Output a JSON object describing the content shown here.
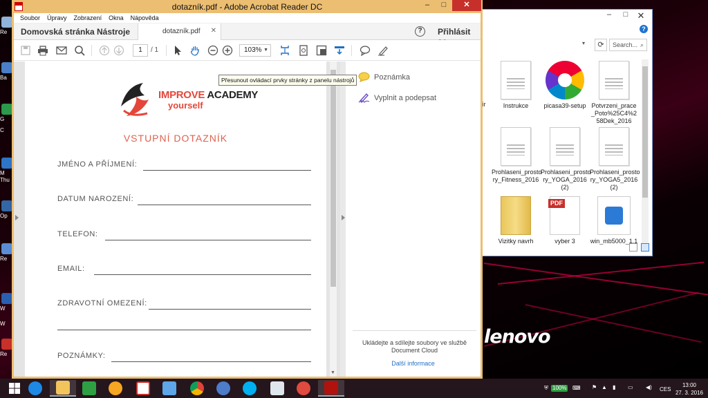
{
  "acrobat": {
    "title": "dotazník.pdf - Adobe Acrobat Reader DC",
    "menu": [
      "Soubor",
      "Úpravy",
      "Zobrazení",
      "Okna",
      "Nápověda"
    ],
    "nav_home": "Domovská stránka",
    "nav_tools": "Nástroje",
    "doc_tab": "dotazník.pdf",
    "sign_in": "Přihlásit se",
    "help": "?",
    "page_current": "1",
    "page_total": "/ 1",
    "zoom": "103%",
    "tooltip": "Přesunout ovládací prvky stránky z panelu nástrojů",
    "window_buttons": {
      "minimize": "–",
      "maximize": "□",
      "close": "✕"
    }
  },
  "document": {
    "logo_word1": "IMPROVE",
    "logo_word2": "ACADEMY",
    "logo_line2": "yourself",
    "form_title": "VSTUPNÍ DOTAZNÍK",
    "fields": {
      "name": "JMÉNO A PŘÍJMENÍ:",
      "birth": "DATUM NAROZENÍ:",
      "phone": "TELEFON:",
      "email": "EMAIL:",
      "health": "ZDRAVOTNÍ OMEZENÍ:",
      "notes": "POZNÁMKY:"
    }
  },
  "right_panel": {
    "comment": "Poznámka",
    "fill_sign": "Vyplnit a podepsat",
    "cloud_text": "Ukládejte a sdílejte soubory ve službě Document Cloud",
    "more_info": "Další informace"
  },
  "explorer": {
    "search_placeholder": "Search...",
    "files": [
      "Instrukce",
      "picasa39-setup",
      "Potvrzeni_prace_Poto%25C4%258Dek_2016",
      "Prohlaseni_prosto ry_Fitness_2016",
      "Prohlaseni_prosto ry_YOGA_2016 (2)",
      "Prohlaseni_prosto ry_YOGA5_2016 (2)",
      "Vizitky navrh",
      "vyber 3",
      "win_mb5000_1.1"
    ],
    "partial_left": "ír"
  },
  "desktop": {
    "brand": "lenovo",
    "left_labels": [
      "Re",
      "Ba",
      "G",
      "C",
      "M",
      "Thu",
      "Op",
      "Re",
      "W",
      "W",
      "Re"
    ]
  },
  "taskbar": {
    "time": "13:00",
    "date": "27. 3. 2016",
    "language": "CES",
    "battery": "100%"
  },
  "colors": {
    "acrobat_frame": "#ecbe72",
    "accent_red": "#e4473a",
    "link_blue": "#1f6fc5",
    "close_red": "#c7302a"
  }
}
